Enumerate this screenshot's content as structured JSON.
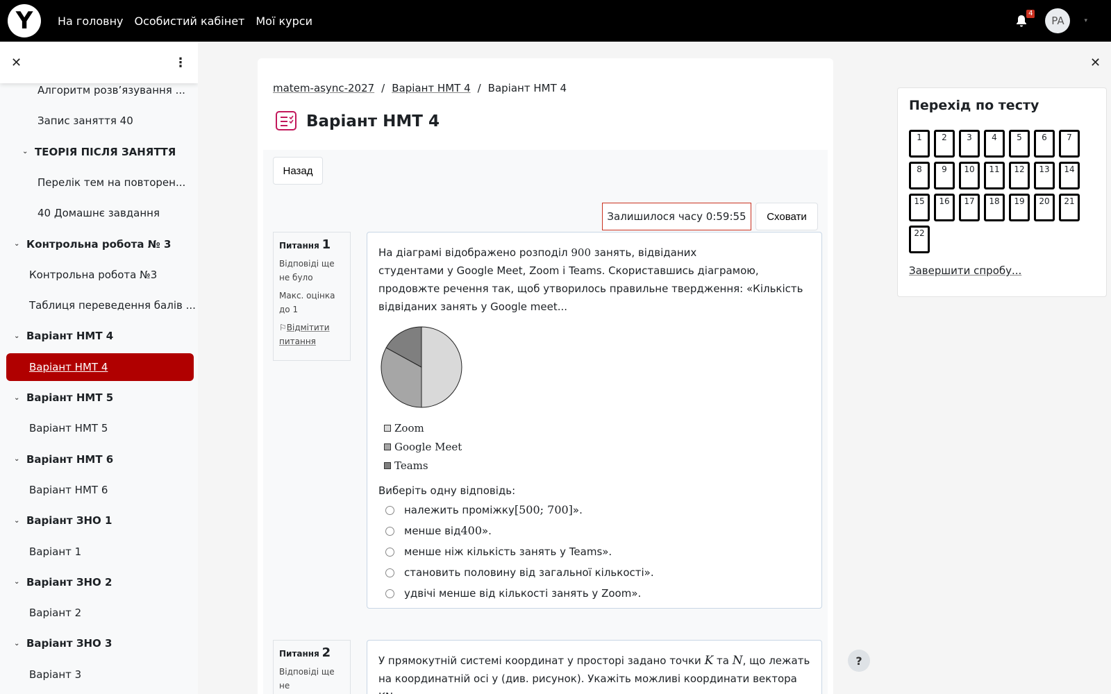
{
  "navbar": {
    "logo_letter": "Y",
    "links": [
      "На головну",
      "Особистий кабінет",
      "Мої курси"
    ],
    "notification_count": "4",
    "avatar_initials": "PA"
  },
  "drawer": {
    "items": [
      {
        "label": "Алгоритм розв’язування ...",
        "type": "item",
        "indent": 2
      },
      {
        "label": "Запис заняття 40",
        "type": "item",
        "indent": 2
      },
      {
        "label": "ТЕОРІЯ ПІСЛЯ ЗАНЯТТЯ",
        "type": "section",
        "indent": 1
      },
      {
        "label": "Перелік тем на повторен...",
        "type": "item",
        "indent": 2
      },
      {
        "label": "40 Домашнє завдання",
        "type": "item",
        "indent": 2
      },
      {
        "label": "Контрольна робота № 3",
        "type": "section",
        "indent": 0
      },
      {
        "label": "Контрольна робота №3",
        "type": "item",
        "indent": 1
      },
      {
        "label": "Таблиця переведення балів ...",
        "type": "item",
        "indent": 1
      },
      {
        "label": "Варіант НМТ 4",
        "type": "section",
        "indent": 0
      },
      {
        "label": "Варіант НМТ 4",
        "type": "active",
        "indent": 1
      },
      {
        "label": "Варіант НМТ 5",
        "type": "section",
        "indent": 0
      },
      {
        "label": "Варіант НМТ 5",
        "type": "item",
        "indent": 1
      },
      {
        "label": "Варіант НМТ 6",
        "type": "section",
        "indent": 0
      },
      {
        "label": "Варіант НМТ 6",
        "type": "item",
        "indent": 1
      },
      {
        "label": "Варіант ЗНО 1",
        "type": "section",
        "indent": 0
      },
      {
        "label": "Варіант 1",
        "type": "item",
        "indent": 1
      },
      {
        "label": "Варіант ЗНО 2",
        "type": "section",
        "indent": 0
      },
      {
        "label": "Варіант 2",
        "type": "item",
        "indent": 1
      },
      {
        "label": "Варіант ЗНО 3",
        "type": "section",
        "indent": 0
      },
      {
        "label": "Варіант 3",
        "type": "item",
        "indent": 1
      }
    ]
  },
  "breadcrumb": [
    "matem-async-2027",
    "Варіант НМТ 4",
    "Варіант НМТ 4"
  ],
  "page_title": "Варіант НМТ 4",
  "back_label": "Назад",
  "timer_label": "Залишилося часу 0:59:55",
  "hide_label": "Сховати",
  "question1": {
    "label": "Питання",
    "number": "1",
    "status": "Відповіді ще не було",
    "max_grade": "Макс. оцінка до 1",
    "flag_label": "Відмітити питання",
    "text_a": "На діаграмі відображено розподіл ",
    "text_num": "900",
    "text_b": " занять, відвіданих",
    "text_c": "студентами у Google Meet, Zoom і Teams. Скориставшись діаграмою, продовжте речення так, щоб утворилось правильне твердження: «Кількість відвіданих занять у Google meet...",
    "chart_data": {
      "type": "pie",
      "categories": [
        "Zoom",
        "Google Meet",
        "Teams"
      ],
      "values": [
        50,
        33,
        17
      ],
      "colors": [
        "#d9d9d9",
        "#a6a6a6",
        "#7f7f7f"
      ]
    },
    "answer_prompt": "Виберіть одну відповідь:",
    "options": [
      {
        "pre": "належить проміжку ",
        "math": "[500; 700]",
        "post": "»."
      },
      {
        "pre": "менше від ",
        "math": "400",
        "post": "»."
      },
      {
        "pre": "менше ніж кількість занять у Teams».",
        "math": "",
        "post": ""
      },
      {
        "pre": "становить половину від загальної кількості».",
        "math": "",
        "post": ""
      },
      {
        "pre": "удвічі менше від кількості занять у Zoom».",
        "math": "",
        "post": ""
      }
    ]
  },
  "question2": {
    "label": "Питання",
    "number": "2",
    "status": "Відповіді ще не",
    "text_a": "У прямокутній системі координат у просторі задано точки ",
    "k": "K",
    "ta": " та ",
    "n": "N",
    "text_b": ", що лежать",
    "text_c": "на координатній осі y (див. рисунок). Укажіть можливі координати вектора KN"
  },
  "quiz_nav": {
    "title": "Перехід по тесту",
    "numbers": [
      "1",
      "2",
      "3",
      "4",
      "5",
      "6",
      "7",
      "8",
      "9",
      "10",
      "11",
      "12",
      "13",
      "14",
      "15",
      "16",
      "17",
      "18",
      "19",
      "20",
      "21",
      "22"
    ],
    "finish_label": "Завершити спробу..."
  },
  "help_label": "?"
}
